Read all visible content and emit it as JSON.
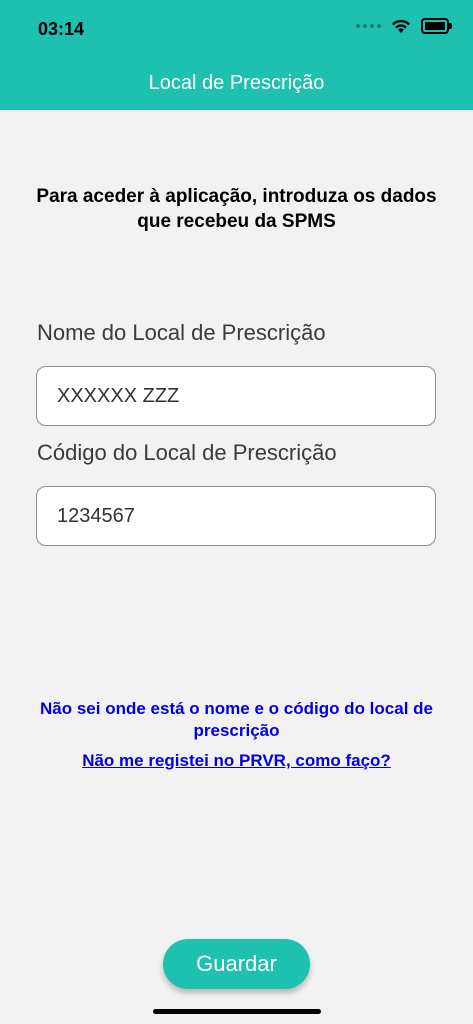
{
  "status_bar": {
    "time": "03:14",
    "icons": [
      "signal-icon",
      "wifi-icon",
      "battery-icon"
    ]
  },
  "nav": {
    "title": "Local de Prescrição"
  },
  "intro_text": "Para aceder à aplicação, introduza os dados que recebeu da SPMS",
  "form": {
    "name_label": "Nome do Local de Prescrição",
    "name_value": "XXXXXX ZZZ",
    "code_label": "Código do Local de Prescrição",
    "code_value": "1234567"
  },
  "links": {
    "help_name_code": "Não sei onde está o nome e o código do local de prescrição",
    "not_registered": "Não me registei no PRVR, como faço?"
  },
  "actions": {
    "save_label": "Guardar"
  },
  "colors": {
    "accent": "#1ec1b0",
    "link": "#0000e6",
    "background": "#f2f2f2"
  }
}
